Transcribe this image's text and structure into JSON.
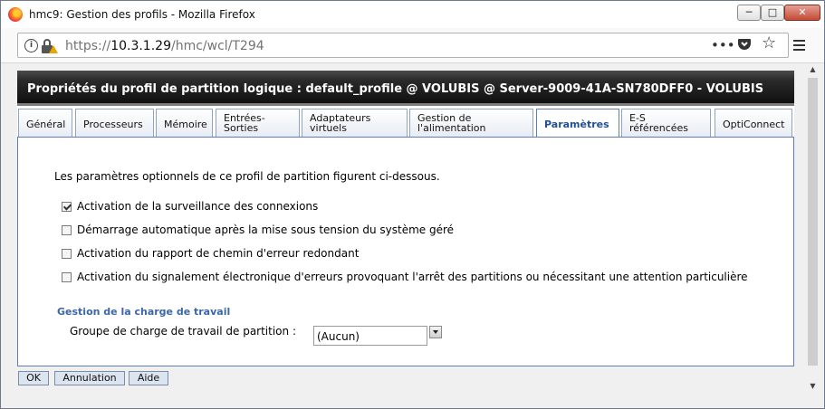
{
  "browser": {
    "window_title": "hmc9: Gestion des profils - Mozilla Firefox",
    "url_prefix": "https://",
    "url_host": "10.3.1.29",
    "url_path": "/hmc/wcl/T294",
    "window_buttons": {
      "minimize": "─",
      "maximize": "□",
      "close": "✕"
    },
    "toolbar_icons": {
      "more": "•••",
      "pocket": "pocket-icon",
      "bookmark": "☆",
      "menu": "hamburger-menu-icon"
    }
  },
  "dialog": {
    "title": "Propriétés du profil de partition logique : default_profile @ VOLUBIS @ Server-9009-41A-SN780DFF0 - VOLUBIS",
    "tabs": [
      {
        "label": "Général",
        "active": false
      },
      {
        "label": "Processeurs",
        "active": false
      },
      {
        "label": "Mémoire",
        "active": false
      },
      {
        "label": "Entrées-\nSorties",
        "active": false
      },
      {
        "label": "Adaptateurs\nvirtuels",
        "active": false
      },
      {
        "label": "Gestion de\nl'alimentation",
        "active": false
      },
      {
        "label": "Paramètres",
        "active": true
      },
      {
        "label": "E-S\nréférencées",
        "active": false
      },
      {
        "label": "OptiConnect",
        "active": false
      }
    ],
    "intro": "Les paramètres optionnels de ce profil de partition figurent ci-dessous.",
    "options": [
      {
        "label": "Activation de la surveillance des connexions",
        "checked": true
      },
      {
        "label": "Démarrage automatique après la mise sous tension du système géré",
        "checked": false
      },
      {
        "label": "Activation du rapport de chemin d'erreur redondant",
        "checked": false
      },
      {
        "label": "Activation du signalement électronique d'erreurs provoquant l'arrêt des partitions ou nécessitant une attention particulière",
        "checked": false
      }
    ],
    "workload": {
      "section_title": "Gestion de la charge de travail",
      "group_label": "Groupe de charge de travail de partition :",
      "group_value": "(Aucun)"
    },
    "buttons": {
      "ok": "OK",
      "cancel": "Annulation",
      "help": "Aide"
    }
  }
}
